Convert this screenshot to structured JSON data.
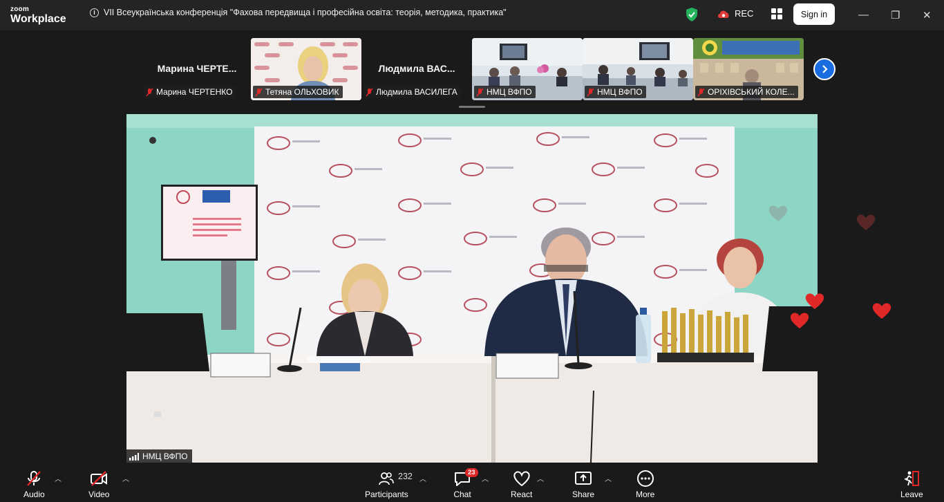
{
  "app": {
    "brand_top": "zoom",
    "brand_bottom": "Workplace"
  },
  "meeting": {
    "title": "VII Всеукраїнська конференція \"Фахова передвища і професійна освіта: теорія, методика, практика\""
  },
  "status": {
    "rec_label": "REC"
  },
  "header": {
    "signin_label": "Sign in",
    "minimize": "—",
    "restore": "❐",
    "close": "✕"
  },
  "filmstrip": {
    "tiles": [
      {
        "big_name": "Марина  ЧЕРТЕ...",
        "label": "Марина ЧЕРТЕНКО"
      },
      {
        "big_name": "",
        "label": "Тетяна ОЛЬХОВИК"
      },
      {
        "big_name": "Людмила  ВАС...",
        "label": "Людмила ВАСИЛЕГА"
      },
      {
        "big_name": "",
        "label": "НМЦ ВФПО"
      },
      {
        "big_name": "",
        "label": "НМЦ ВФПО"
      },
      {
        "big_name": "",
        "label": "ОРІХІВСЬКИЙ КОЛЕ..."
      }
    ]
  },
  "main_video": {
    "label": "НМЦ ВФПО"
  },
  "toolbar": {
    "audio": "Audio",
    "video": "Video",
    "participants": "Participants",
    "participants_count": "232",
    "chat": "Chat",
    "chat_badge": "23",
    "react": "React",
    "share": "Share",
    "more": "More",
    "leave": "Leave"
  },
  "colors": {
    "accent": "#1a6de0",
    "leave": "#e02828",
    "muted": "#e02828"
  }
}
